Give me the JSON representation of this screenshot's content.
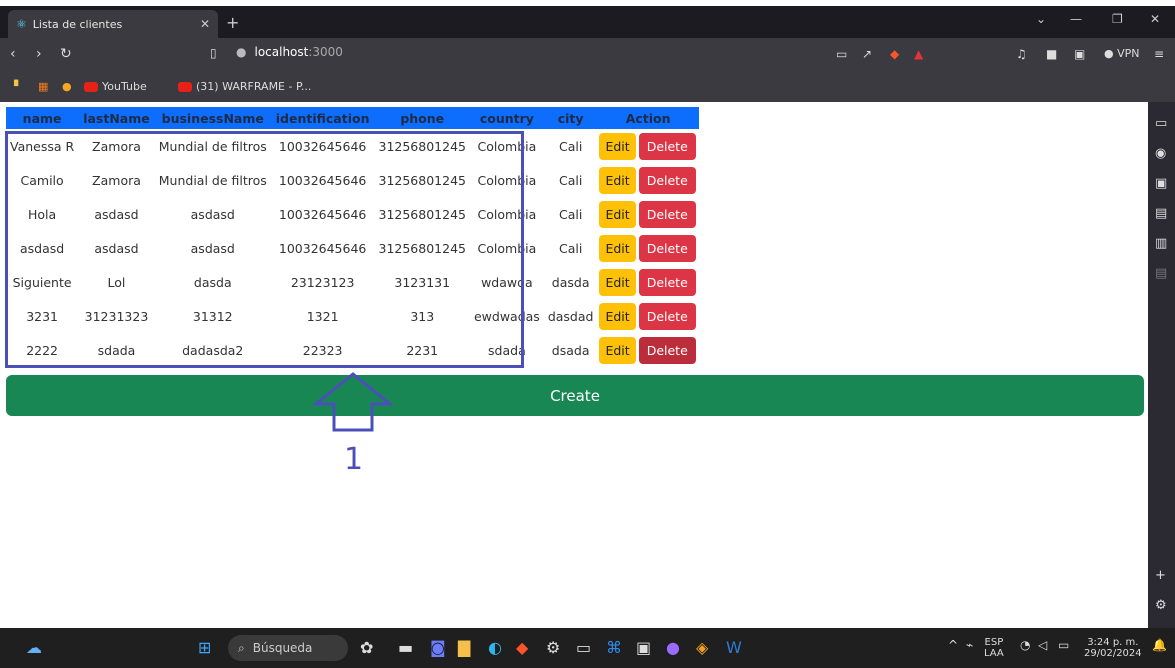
{
  "browser": {
    "tab_title": "Lista de clientes",
    "url_host": "localhost",
    "url_port": ":3000",
    "vpn_label": "VPN",
    "bookmarks": [
      "YouTube",
      "(31) WARFRAME - P..."
    ]
  },
  "table": {
    "headers": [
      "name",
      "lastName",
      "businessName",
      "identification",
      "phone",
      "country",
      "city",
      "Action"
    ],
    "rows": [
      [
        "Vanessa R",
        "Zamora",
        "Mundial de filtros",
        "10032645646",
        "31256801245",
        "Colombia",
        "Cali"
      ],
      [
        "Camilo",
        "Zamora",
        "Mundial de filtros",
        "10032645646",
        "31256801245",
        "Colombia",
        "Cali"
      ],
      [
        "Hola",
        "asdasd",
        "asdasd",
        "10032645646",
        "31256801245",
        "Colombia",
        "Cali"
      ],
      [
        "asdasd",
        "asdasd",
        "asdasd",
        "10032645646",
        "31256801245",
        "Colombia",
        "Cali"
      ],
      [
        "Siguiente",
        "Lol",
        "dasda",
        "23123123",
        "3123131",
        "wdawda",
        "dasda"
      ],
      [
        "3231",
        "31231323",
        "31312",
        "1321",
        "313",
        "ewdwadas",
        "dasdad"
      ],
      [
        "2222",
        "sdada",
        "dadasda2",
        "22323",
        "2231",
        "sdada",
        "dsada"
      ]
    ],
    "edit_label": "Edit",
    "delete_label": "Delete"
  },
  "create_label": "Create",
  "annotation_number": "1",
  "taskbar": {
    "search_placeholder": "Búsqueda",
    "lang_line1": "ESP",
    "lang_line2": "LAA",
    "time": "3:24 p. m.",
    "date": "29/02/2024"
  },
  "colors": {
    "header_bg": "#0d6efd",
    "edit": "#ffc107",
    "delete": "#dc3545",
    "create": "#198754",
    "annotation": "#4a50b8"
  }
}
